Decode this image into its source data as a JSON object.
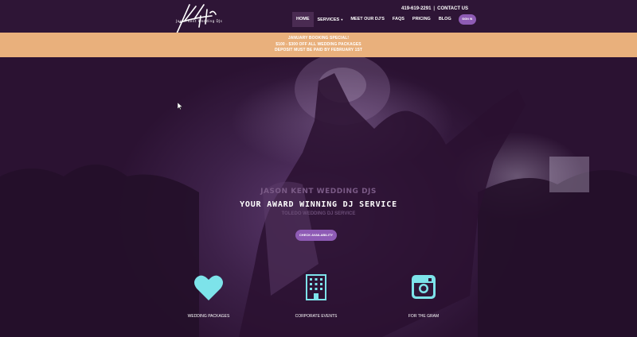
{
  "header": {
    "logo_text": "Jason Kent Wedding DJs",
    "phone": "419-619-2291",
    "separator": "|",
    "contact_label": "CONTACT US"
  },
  "nav": {
    "items": [
      {
        "label": "HOME",
        "active": true
      },
      {
        "label": "SERVICES",
        "dropdown": true
      },
      {
        "label": "MEET OUR DJ'S"
      },
      {
        "label": "FAQS"
      },
      {
        "label": "PRICING"
      },
      {
        "label": "BLOG"
      }
    ],
    "sign_in_label": "SIGN IN"
  },
  "promo": {
    "line1": "JANUARY BOOKING SPECIAL!",
    "line2": "$100 - $300 OFF ALL WEDDING PACKAGES",
    "line3": "DEPOSIT MUST BE PAID BY FEBRUARY 1ST"
  },
  "hero": {
    "title1": "JASON KENT WEDDING DJS",
    "title2": "YOUR AWARD WINNING DJ SERVICE",
    "title3": "TOLEDO WEDDING DJ SERVICE",
    "cta_label": "CHECK AVAILABILITY"
  },
  "features": [
    {
      "label": "WEDDING PACKAGES",
      "icon": "heart-icon"
    },
    {
      "label": "CORPORATE EVENTS",
      "icon": "building-icon"
    },
    {
      "label": "FOR THE GRAM",
      "icon": "instagram-icon"
    }
  ],
  "colors": {
    "header_bg": "#2e1536",
    "promo_bg": "#e9b07c",
    "accent_purple": "#8e5bb5",
    "icon_cyan": "#7de3ea"
  }
}
